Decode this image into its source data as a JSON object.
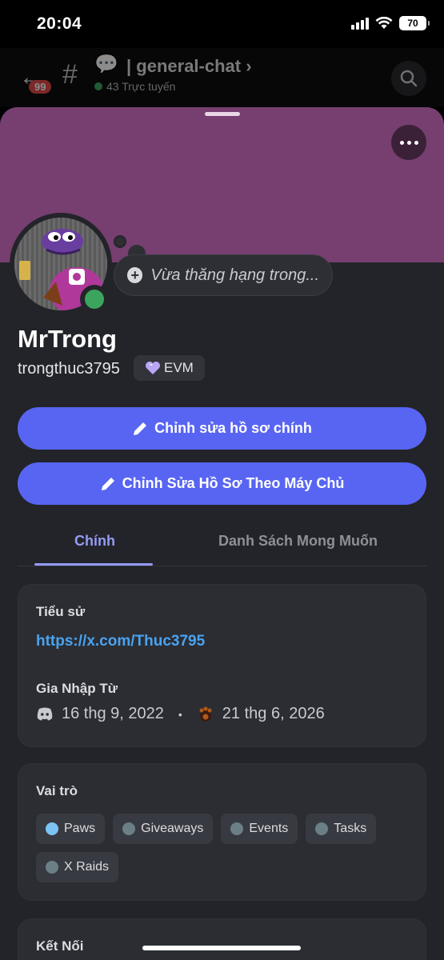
{
  "status_bar": {
    "time": "20:04",
    "battery": "70"
  },
  "channel_header": {
    "unread_count": "99",
    "channel_name": "general-chat",
    "online_text": "43 Trực tuyến"
  },
  "profile": {
    "custom_status": "Vừa thăng hạng trong...",
    "display_name": "MrTrong",
    "username": "trongthuc3795",
    "tag": "EVM"
  },
  "actions": {
    "edit_main": "Chỉnh sửa hồ sơ chính",
    "edit_server": "Chỉnh Sửa Hồ Sơ Theo Máy Chủ"
  },
  "tabs": [
    {
      "label": "Chính",
      "active": true
    },
    {
      "label": "Danh Sách Mong Muốn",
      "active": false
    }
  ],
  "bio": {
    "label": "Tiểu sử",
    "link": "https://x.com/Thuc3795",
    "joined_label": "Gia Nhập Từ",
    "discord_join_date": "16 thg 9, 2022",
    "server_join_date": "21 thg 6, 2026"
  },
  "roles": {
    "label": "Vai trò",
    "items": [
      {
        "name": "Paws",
        "color": "#7cc4f5"
      },
      {
        "name": "Giveaways",
        "color": "#6b7f86"
      },
      {
        "name": "Events",
        "color": "#6b7f86"
      },
      {
        "name": "Tasks",
        "color": "#6b7f86"
      },
      {
        "name": "X Raids",
        "color": "#6b7f86"
      }
    ]
  },
  "connections": {
    "label": "Kết Nối"
  },
  "colors": {
    "accent": "#5865f2",
    "banner": "#763f70",
    "link": "#4aa3f0",
    "online": "#3ba55d"
  }
}
